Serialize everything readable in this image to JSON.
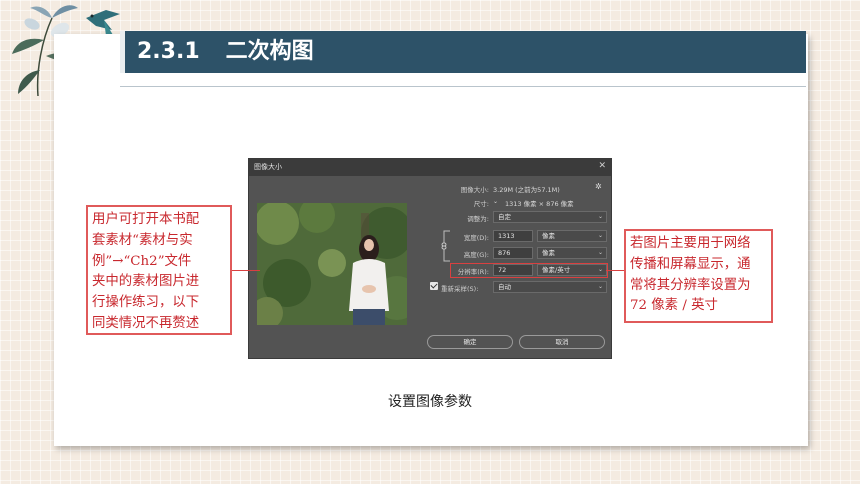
{
  "slide": {
    "section_number": "2.3.1",
    "section_title": "二次构图",
    "caption": "设置图像参数"
  },
  "colors": {
    "title_bar": "#2d5268",
    "annotation_red": "#c8282e",
    "dialog_bg": "#535353",
    "page_bg": "#f4ebe1"
  },
  "dialog": {
    "title": "图像大小",
    "close_icon": "close-icon",
    "image_size_label": "图像大小:",
    "image_size_value": "3.29M (之前为57.1M)",
    "settings_icon": "gear-icon",
    "dimensions_label": "尺寸:",
    "dimensions_value": "1313 像素 × 876 像素",
    "fit_to_label": "调整为:",
    "fit_to_value": "自定",
    "width_label": "宽度(D):",
    "width_value": "1313",
    "width_unit": "像素",
    "height_label": "高度(G):",
    "height_value": "876",
    "height_unit": "像素",
    "resolution_label": "分辨率(R):",
    "resolution_value": "72",
    "resolution_unit": "像素/英寸",
    "resample_checked": true,
    "resample_label": "重新采样(S):",
    "resample_value": "自动",
    "ok_label": "确定",
    "cancel_label": "取消"
  },
  "annotations": {
    "left_lines": [
      "用户可打开本书配",
      "套素材“素材与实",
      "例”→“Ch2”文件",
      "夹中的素材图片进",
      "行操作练习，以下",
      "同类情况不再赘述"
    ],
    "right_lines": [
      "若图片主要用于网络",
      "传播和屏幕显示，通",
      "常将其分辨率设置为",
      "72 像素 / 英寸"
    ]
  }
}
